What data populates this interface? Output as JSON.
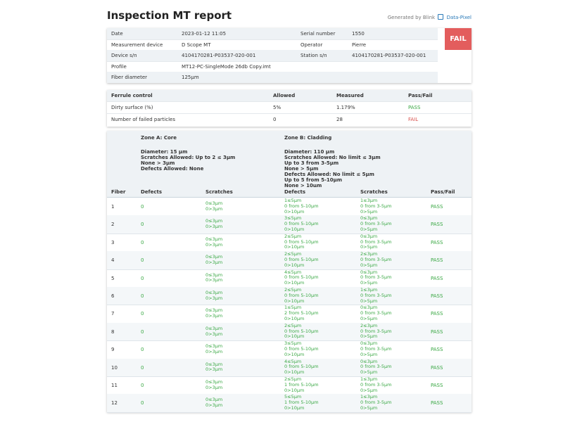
{
  "title": "Inspection MT report",
  "generated_by": "Generated by",
  "brand_name": "Blink",
  "brand_link": "Data-Pixel",
  "result": "FAIL",
  "info": {
    "date_label": "Date",
    "date_value": "2023-01-12 11:05",
    "serial_label": "Serial number",
    "serial_value": "1550",
    "device_label": "Measurement device",
    "device_value": "D Scope MT",
    "operator_label": "Operator",
    "operator_value": "Pierre",
    "devsn_label": "Device s/n",
    "devsn_value": "4104170281-P03537-020-001",
    "stationsn_label": "Station s/n",
    "stationsn_value": "4104170281-P03537-020-001",
    "profile_label": "Profile",
    "profile_value": "MT12-PC-SingleMode 26db Copy.imt",
    "fiberdia_label": "Fiber diameter",
    "fiberdia_value": "125μm"
  },
  "ferrule": {
    "head": [
      "Ferrule control",
      "Allowed",
      "Measured",
      "Pass/Fail"
    ],
    "rows": [
      [
        "Dirty surface (%)",
        "5%",
        "1.179%",
        "PASS"
      ],
      [
        "Number of failed particles",
        "0",
        "28",
        "FAIL"
      ]
    ]
  },
  "zone_a": {
    "title": "Zone A: Core",
    "lines": [
      "Diameter: 15 μm",
      "Scratches Allowed: Up to 2 ≤ 3μm",
      "None > 3μm",
      "Defects Allowed: None"
    ]
  },
  "zone_b": {
    "title": "Zone B: Cladding",
    "lines": [
      "Diameter: 110 μm",
      "Scratches Allowed: No limit ≤ 3μm",
      "Up to 3 from 3-5μm",
      "None > 5μm",
      "Defects Allowed: No limit ≤ 5μm",
      "Up to 5 from 5-10μm",
      "None > 10μm"
    ]
  },
  "fiber_headers": [
    "Fiber",
    "Defects",
    "Scratches",
    "Defects",
    "Scratches",
    "Pass/Fail"
  ],
  "fibers": [
    {
      "n": "1",
      "a_def": "0",
      "a_scr": [
        "0≤3μm",
        "0>3μm"
      ],
      "b_def": [
        "1≤5μm",
        "0 from 5-10μm",
        "0>10μm"
      ],
      "b_scr": [
        "1≤3μm",
        "0 from 3-5μm",
        "0>5μm"
      ],
      "pf": "PASS"
    },
    {
      "n": "2",
      "a_def": "0",
      "a_scr": [
        "0≤3μm",
        "0>3μm"
      ],
      "b_def": [
        "3≤5μm",
        "0 from 5-10μm",
        "0>10μm"
      ],
      "b_scr": [
        "0≤3μm",
        "0 from 3-5μm",
        "0>5μm"
      ],
      "pf": "PASS"
    },
    {
      "n": "3",
      "a_def": "0",
      "a_scr": [
        "0≤3μm",
        "0>3μm"
      ],
      "b_def": [
        "2≤5μm",
        "0 from 5-10μm",
        "0>10μm"
      ],
      "b_scr": [
        "0≤3μm",
        "0 from 3-5μm",
        "0>5μm"
      ],
      "pf": "PASS"
    },
    {
      "n": "4",
      "a_def": "0",
      "a_scr": [
        "0≤3μm",
        "0>3μm"
      ],
      "b_def": [
        "2≤5μm",
        "0 from 5-10μm",
        "0>10μm"
      ],
      "b_scr": [
        "2≤3μm",
        "0 from 3-5μm",
        "0>5μm"
      ],
      "pf": "PASS"
    },
    {
      "n": "5",
      "a_def": "0",
      "a_scr": [
        "0≤3μm",
        "0>3μm"
      ],
      "b_def": [
        "4≤5μm",
        "0 from 5-10μm",
        "0>10μm"
      ],
      "b_scr": [
        "0≤3μm",
        "0 from 3-5μm",
        "0>5μm"
      ],
      "pf": "PASS"
    },
    {
      "n": "6",
      "a_def": "0",
      "a_scr": [
        "0≤3μm",
        "0>3μm"
      ],
      "b_def": [
        "2≤5μm",
        "0 from 5-10μm",
        "0>10μm"
      ],
      "b_scr": [
        "1≤3μm",
        "0 from 3-5μm",
        "0>5μm"
      ],
      "pf": "PASS"
    },
    {
      "n": "7",
      "a_def": "0",
      "a_scr": [
        "0≤3μm",
        "0>3μm"
      ],
      "b_def": [
        "1≤5μm",
        "2 from 5-10μm",
        "0>10μm"
      ],
      "b_scr": [
        "0≤3μm",
        "0 from 3-5μm",
        "0>5μm"
      ],
      "pf": "PASS"
    },
    {
      "n": "8",
      "a_def": "0",
      "a_scr": [
        "0≤3μm",
        "0>3μm"
      ],
      "b_def": [
        "2≤5μm",
        "0 from 5-10μm",
        "0>10μm"
      ],
      "b_scr": [
        "2≤3μm",
        "0 from 3-5μm",
        "0>5μm"
      ],
      "pf": "PASS"
    },
    {
      "n": "9",
      "a_def": "0",
      "a_scr": [
        "0≤3μm",
        "0>3μm"
      ],
      "b_def": [
        "3≤5μm",
        "0 from 5-10μm",
        "0>10μm"
      ],
      "b_scr": [
        "0≤3μm",
        "0 from 3-5μm",
        "0>5μm"
      ],
      "pf": "PASS"
    },
    {
      "n": "10",
      "a_def": "0",
      "a_scr": [
        "0≤3μm",
        "0>3μm"
      ],
      "b_def": [
        "4≤5μm",
        "0 from 5-10μm",
        "0>10μm"
      ],
      "b_scr": [
        "0≤3μm",
        "0 from 3-5μm",
        "0>5μm"
      ],
      "pf": "PASS"
    },
    {
      "n": "11",
      "a_def": "0",
      "a_scr": [
        "0≤3μm",
        "0>3μm"
      ],
      "b_def": [
        "2≤5μm",
        "1 from 5-10μm",
        "0>10μm"
      ],
      "b_scr": [
        "1≤3μm",
        "0 from 3-5μm",
        "0>5μm"
      ],
      "pf": "PASS"
    },
    {
      "n": "12",
      "a_def": "0",
      "a_scr": [
        "0≤3μm",
        "0>3μm"
      ],
      "b_def": [
        "5≤5μm",
        "1 from 5-10μm",
        "0>10μm"
      ],
      "b_scr": [
        "1≤3μm",
        "0 from 3-5μm",
        "0>5μm"
      ],
      "pf": "PASS"
    }
  ]
}
